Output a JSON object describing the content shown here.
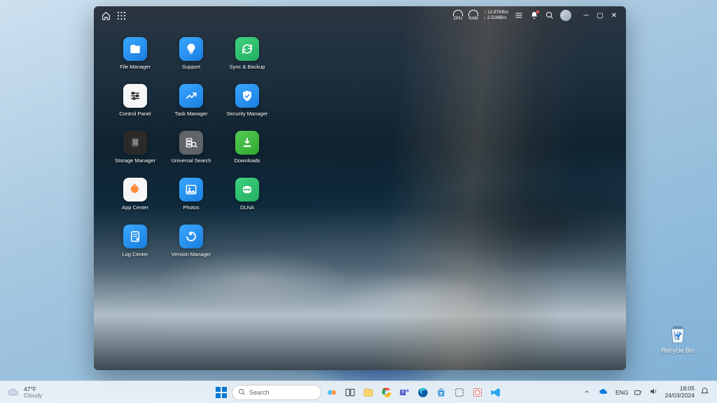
{
  "nas": {
    "stats": {
      "cpu_label": "CPU",
      "ram_label": "RAM",
      "up_speed": "↑ 12.97KB/s",
      "down_speed": "↓ 2.51MB/s"
    },
    "apps": [
      {
        "label": "File Manager",
        "bg": "linear-gradient(145deg,#3aa8ff,#1a7de0)",
        "glyph": "folder"
      },
      {
        "label": "Support",
        "bg": "linear-gradient(145deg,#3aa8ff,#1a7de0)",
        "glyph": "bulb"
      },
      {
        "label": "Sync & Backup",
        "bg": "linear-gradient(145deg,#3fd080,#22b060)",
        "glyph": "sync"
      },
      {
        "label": "Control Panel",
        "bg": "#f5f6f8",
        "glyph": "sliders"
      },
      {
        "label": "Task Manager",
        "bg": "linear-gradient(145deg,#3aa8ff,#1a7de0)",
        "glyph": "chart"
      },
      {
        "label": "Security Manager",
        "bg": "linear-gradient(145deg,#3aa8ff,#1a7de0)",
        "glyph": "shield"
      },
      {
        "label": "Storage Manager",
        "bg": "#2a2a2a",
        "glyph": "storage"
      },
      {
        "label": "Universal Search",
        "bg": "#606368",
        "glyph": "dbsearch"
      },
      {
        "label": "Downloads",
        "bg": "linear-gradient(145deg,#55cc55,#30a830)",
        "glyph": "download"
      },
      {
        "label": "App Center",
        "bg": "#f5f6f8",
        "glyph": "puzzle"
      },
      {
        "label": "Photos",
        "bg": "linear-gradient(145deg,#3aa8ff,#1a7de0)",
        "glyph": "image"
      },
      {
        "label": "DLNA",
        "bg": "linear-gradient(145deg,#3fd080,#22b060)",
        "glyph": "dlna"
      },
      {
        "label": "Log Center",
        "bg": "linear-gradient(145deg,#3aa8ff,#1a7de0)",
        "glyph": "log"
      },
      {
        "label": "Version Manager",
        "bg": "linear-gradient(145deg,#3aa8ff,#1a7de0)",
        "glyph": "restore"
      }
    ]
  },
  "desktop": {
    "recycle_bin_label": "Recycle Bin"
  },
  "taskbar": {
    "weather_temp": "47°F",
    "weather_cond": "Cloudy",
    "search_placeholder": "Search",
    "lang": "ENG",
    "time": "18:05",
    "date": "24/03/2024"
  }
}
